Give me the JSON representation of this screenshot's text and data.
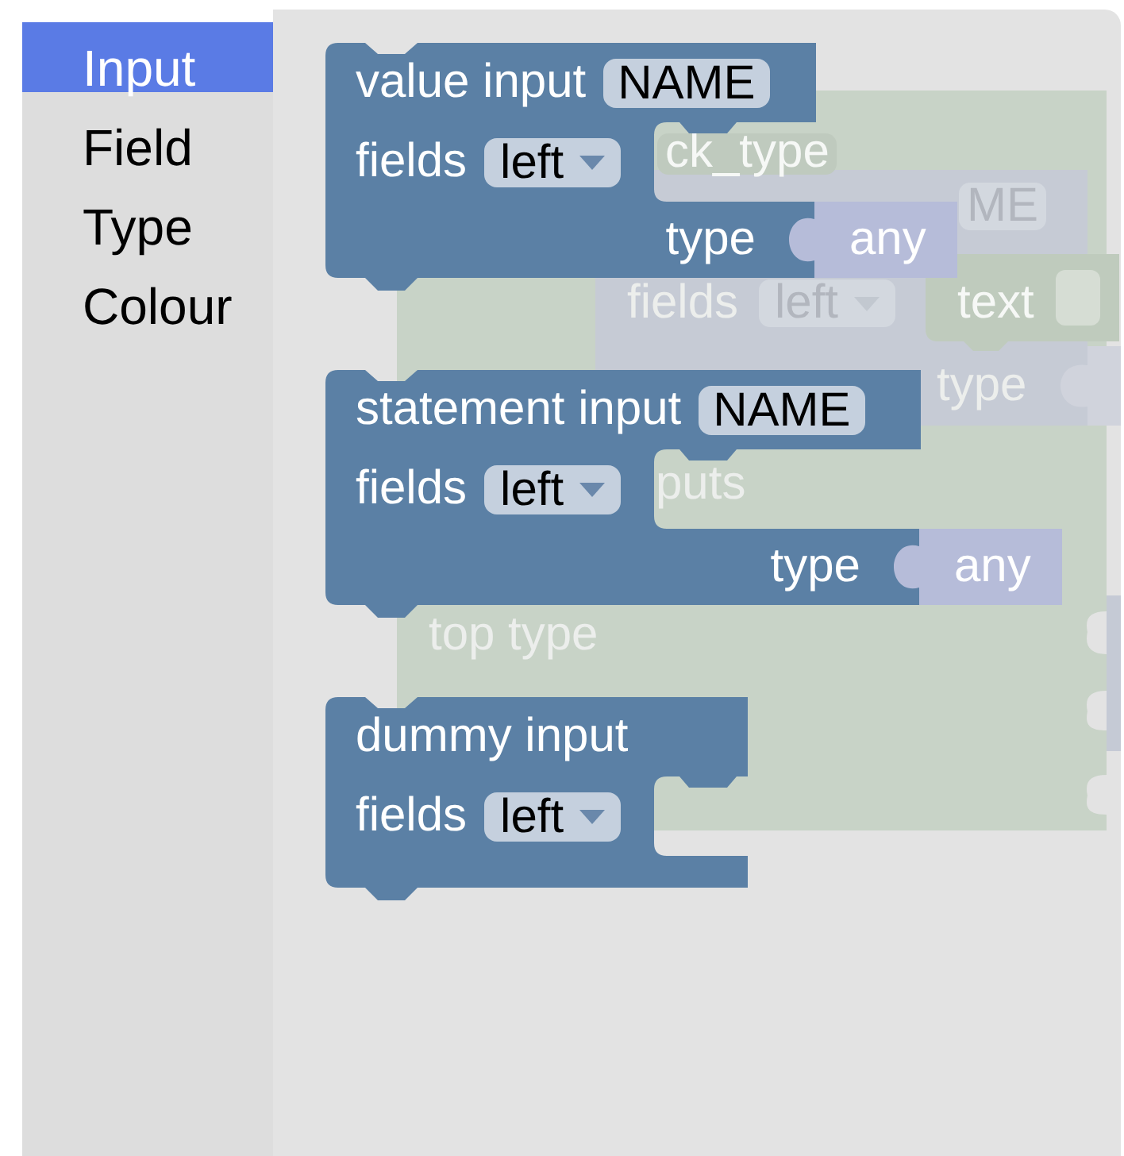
{
  "toolbox": {
    "categories": [
      {
        "label": "Input",
        "selected": true
      },
      {
        "label": "Field",
        "selected": false
      },
      {
        "label": "Type",
        "selected": false
      },
      {
        "label": "Colour",
        "selected": false
      }
    ]
  },
  "flyout": {
    "blocks": [
      {
        "kind": "value_input",
        "title": "value input",
        "name": "NAME",
        "fields_label": "fields",
        "align": "left",
        "type_label": "type",
        "type_block": "any"
      },
      {
        "kind": "statement_input",
        "title": "statement input",
        "name": "NAME",
        "fields_label": "fields",
        "align": "left",
        "type_label": "type",
        "type_block": "any"
      },
      {
        "kind": "dummy_input",
        "title": "dummy input",
        "fields_label": "fields",
        "align": "left"
      }
    ]
  },
  "workspace": {
    "blocks": [
      {
        "kind": "factory_base",
        "name_field": "ck_type",
        "labels": [
          "puts",
          "top type"
        ]
      },
      {
        "kind": "input_block",
        "name_field": "ME",
        "fields_label": "fields",
        "align": "left",
        "type_label": "type"
      },
      {
        "kind": "text_block",
        "label": "text"
      },
      {
        "kind": "value_stub"
      },
      {
        "kind": "value_stub"
      }
    ]
  }
}
